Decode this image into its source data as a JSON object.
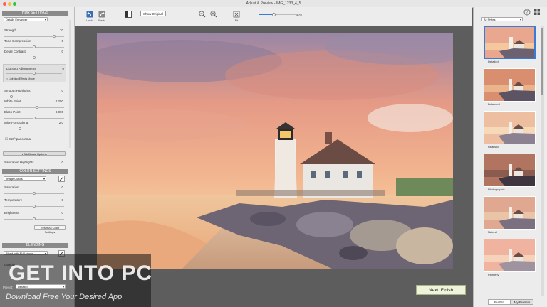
{
  "window": {
    "title": "Adjust & Preview - IMG_1233_4_5",
    "traffic_colors": [
      "#fe5f57",
      "#febc2e",
      "#28c840"
    ]
  },
  "left": {
    "hdr_header": "HDR SETTINGS",
    "preset_dropdown": "Details Enhancer",
    "hdr_rows": [
      {
        "label": "Strength",
        "value": "70",
        "pos": 0.85
      },
      {
        "label": "Tone Compression",
        "value": "0",
        "pos": 0.5
      },
      {
        "label": "Detail Contrast",
        "value": "0",
        "pos": 0.5
      }
    ],
    "lighting_label": "Lighting Adjustments",
    "lighting_value": "0",
    "lighting_pos": 0.5,
    "lighting_mode": "Lighting Effects Mode",
    "hdr_rows2": [
      {
        "label": "Smooth Highlights",
        "value": "0",
        "pos": 0.1
      },
      {
        "label": "White Point",
        "value": "0.250",
        "pos": 0.55
      },
      {
        "label": "Black Point",
        "value": "0.000",
        "pos": 0.5
      },
      {
        "label": "Micro-smoothing",
        "value": "2.0",
        "pos": 0.25
      }
    ],
    "panorama_label": "360º panorama",
    "additional_options": "Additional Options",
    "saturation_highlights_label": "Saturation Highlights",
    "saturation_highlights_value": "0",
    "color_header": "COLOR SETTINGS",
    "color_dropdown": "Image Colors",
    "color_rows": [
      {
        "label": "Saturation",
        "value": "0",
        "pos": 0.5
      },
      {
        "label": "Temperature",
        "value": "0",
        "pos": 0.5
      },
      {
        "label": "Brightness",
        "value": "0",
        "pos": 0.5
      }
    ],
    "reset_colors": "Reset All Color Settings",
    "blending_header": "BLENDING",
    "blend_dropdown": "Blend with EV0 photo",
    "opacity_label": "Opacity",
    "preset_label": "Preset:",
    "preset_value": "Detailed"
  },
  "toolbar": {
    "undo_label": "Undo",
    "redo_label": "Redo",
    "show_original": "Show Original",
    "fit_label": "Fit",
    "zoom_level": 0.4,
    "zoom_text": "50%"
  },
  "right": {
    "styles_dropdown": "All Styles",
    "thumbnails": [
      "Detailed",
      "Balanced",
      "Realistic",
      "Photographic",
      "Natural",
      "Painterly"
    ],
    "tab_builtin": "Built-In",
    "tab_mypresets": "My Presets"
  },
  "main": {
    "next_button": "Next: Finish"
  },
  "watermark": {
    "title": "GET INTO PC",
    "subtitle": "Download Free Your Desired App"
  },
  "colors": {
    "accent": "#3a7bd5",
    "next_bg": "#eef4da"
  }
}
